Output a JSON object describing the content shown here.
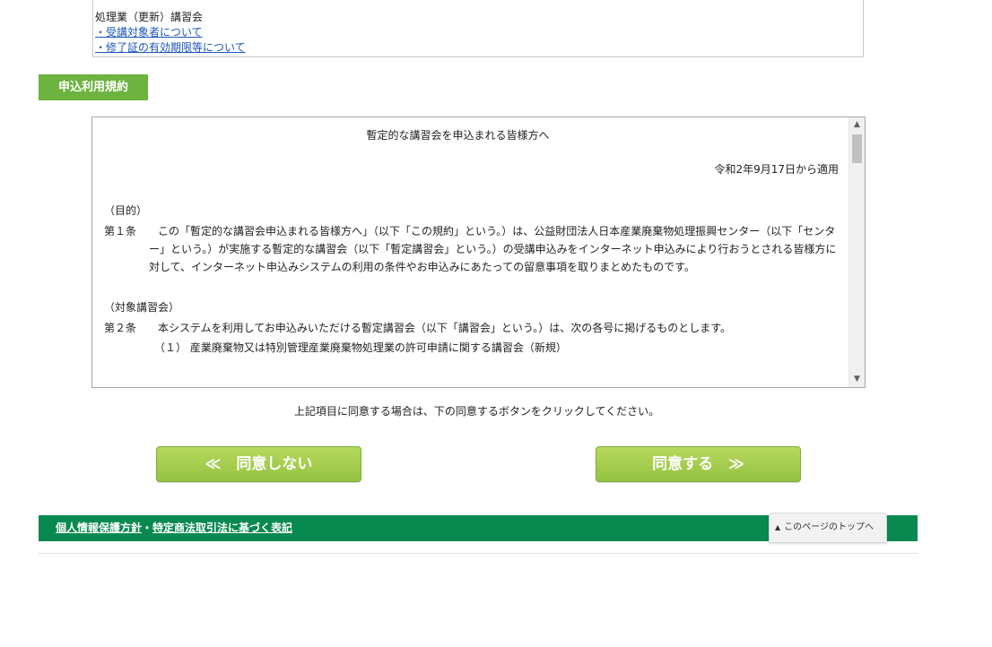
{
  "info_box": {
    "label": "処理業（更新）講習会",
    "link_target_persons": "・受講対象者について",
    "link_validity": "・修了証の有効期限等について"
  },
  "section_heading": "申込利用規約",
  "terms": {
    "title": "暫定的な講習会を申込まれる皆様方へ",
    "effective_date": "令和2年9月17日から適用",
    "section1_heading": "（目的）",
    "article1_number": "第１条",
    "article1_text": "この「暫定的な講習会申込まれる皆様方へ」（以下「この規約」という。）は、公益財団法人日本産業廃棄物処理振興センター（以下「センター」という。）が実施する暫定的な講習会（以下「暫定講習会」という。）の受講申込みをインターネット申込みにより行おうとされる皆様方に対して、インターネット申込みシステムの利用の条件やお申込みにあたっての留意事項を取りまとめたものです。",
    "section2_heading": "（対象講習会）",
    "article2_number": "第２条",
    "article2_text": "本システムを利用してお申込みいただける暫定講習会（以下「講習会」という。）は、次の各号に掲げるものとします。",
    "article2_item1": "（１） 産業廃棄物又は特別管理産業廃棄物処理業の許可申請に関する講習会（新規）"
  },
  "instruction": "上記項目に同意する場合は、下の同意するボタンをクリックしてください。",
  "buttons": {
    "disagree": "≪　同意しない",
    "agree": "同意する　≫"
  },
  "footer": {
    "privacy_link": "個人情報保護方針",
    "separator": "・",
    "commerce_link": "特定商法取引法に基づく表記",
    "page_top": "このページのトップへ"
  },
  "colors": {
    "accent_green": "#6cb33f",
    "footer_green": "#08894f",
    "link_blue": "#1a56b8"
  }
}
